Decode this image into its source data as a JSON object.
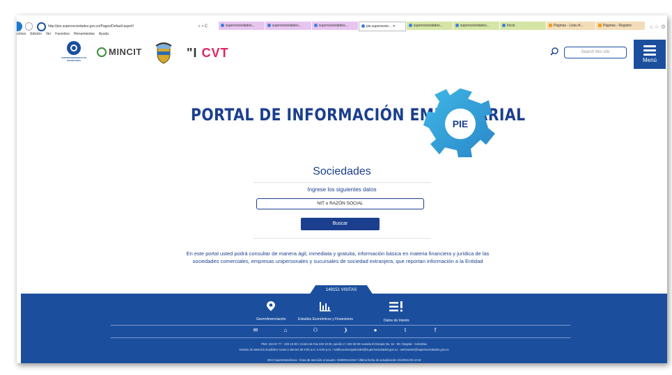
{
  "browser": {
    "url": "http://pie.supersociedades.gov.co/Pages/Default.aspx#/",
    "url_tools": "⌕ ▾ C",
    "tabs": [
      {
        "label": "supersociedades...",
        "style": "pink"
      },
      {
        "label": "supersociedades...",
        "style": "pink"
      },
      {
        "label": "supersociedades...",
        "style": "pink"
      },
      {
        "label": "pie.supersocie... ✕",
        "style": "active"
      },
      {
        "label": "supersociedades...",
        "style": "green"
      },
      {
        "label": "supersociedades...",
        "style": "green"
      },
      {
        "label": "Inicio",
        "style": "green"
      },
      {
        "label": "Páginas - Lista of...",
        "style": "orange"
      },
      {
        "label": "Páginas - Registro",
        "style": "orange"
      }
    ],
    "window_icons": "⌂☆⚙",
    "menu": [
      "rchivo",
      "Edición",
      "Ver",
      "Favoritos",
      "Herramientas",
      "Ayuda"
    ]
  },
  "header": {
    "logo_ss_text": "SUPERINTENDENCIA DE SOCIEDADES",
    "mincit": "MINCIT",
    "cvt_prefix": "\"I",
    "cvt_suffix": "CVT",
    "search_placeholder": "Search this site",
    "menu_label": "Menú"
  },
  "hero": {
    "title": "PORTAL DE INFORMACIÓN EMPRESARIAL",
    "pie_label": "PIE"
  },
  "form": {
    "title": "Sociedades",
    "subtitle": "Ingrese los siguientes datos",
    "input_placeholder": "NIT o RAZÓN SOCIAL",
    "button": "Buscar"
  },
  "description": "En este portal usted podrá consultar de manera ágil, inmediata y gratuita, información básica en materia financiera y jurídica de las sociedades comerciales, empresas unipersonales y sucursales de sociedad extranjera, que reportan información a la Entidad",
  "footer": {
    "visits": "149151 VISITAS",
    "items": [
      {
        "icon": "location-pin-icon",
        "label": "Georreferenciación"
      },
      {
        "icon": "bar-chart-icon",
        "label": "Estudios Económicos y Financieros"
      },
      {
        "icon": "list-alert-icon",
        "label": "Datos de Interés"
      }
    ],
    "social": [
      "✉",
      "⌂",
      "⚇",
      "❩",
      "●",
      "t",
      "f"
    ],
    "line1": "PBX: 324 57 77 - 220 10 00 / Centro de Fax 220 10 00, opción 2 / 324 50 00 Avenida El Dorado No. 51 - 80 / Bogotá - Colombia",
    "line2": "Horario de atención al público: lunes a viernes de 8:00 a.m. a 5:00 p.m. / notificacionesjudiciales@supersociedades.gov.co - webmaster@supersociedades.gov.co",
    "line3": "2013 Superintendencia - línea de atención al usuario: 018000114319 / Última fecha de actualización 3/1/2016 06:13:10"
  }
}
